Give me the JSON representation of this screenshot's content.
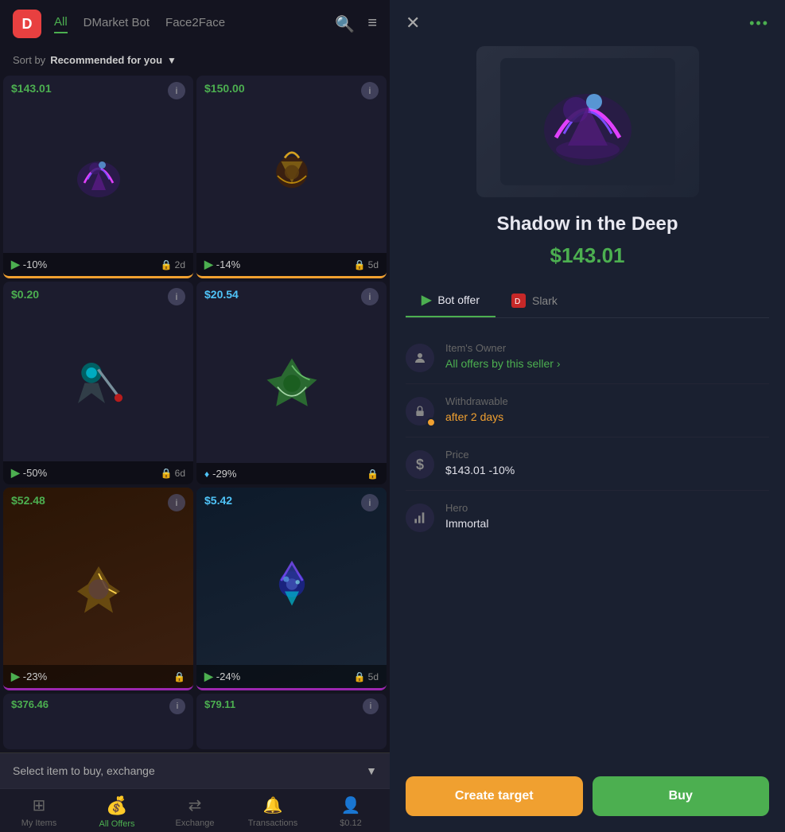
{
  "app": {
    "logo": "D",
    "logo_bg": "#e84040"
  },
  "header": {
    "tabs": [
      {
        "id": "all",
        "label": "All",
        "active": true
      },
      {
        "id": "dmarket",
        "label": "DMarket Bot",
        "active": false
      },
      {
        "id": "face2face",
        "label": "Face2Face",
        "active": false
      }
    ],
    "search_icon": "🔍",
    "filter_icon": "⚙"
  },
  "sort": {
    "prefix": "Sort by",
    "value": "Recommended for you",
    "chevron": "▼"
  },
  "items": [
    {
      "id": 1,
      "price": "$143.01",
      "price_color": "green",
      "discount": "-10%",
      "lock": "2d",
      "border": "yellow",
      "source": "dmarket"
    },
    {
      "id": 2,
      "price": "$150.00",
      "price_color": "green",
      "discount": "-14%",
      "lock": "5d",
      "border": "yellow",
      "source": "dmarket"
    },
    {
      "id": 3,
      "price": "$0.20",
      "price_color": "green",
      "discount": "-50%",
      "lock": "6d",
      "border": "none",
      "source": "dmarket"
    },
    {
      "id": 4,
      "price": "$20.54",
      "price_color": "blue",
      "discount": "-29%",
      "lock": "",
      "border": "none",
      "source": "steam"
    },
    {
      "id": 5,
      "price": "$52.48",
      "price_color": "green",
      "discount": "-23%",
      "lock": "",
      "border": "purple",
      "source": "dmarket"
    },
    {
      "id": 6,
      "price": "$5.42",
      "price_color": "blue",
      "discount": "-24%",
      "lock": "5d",
      "border": "purple",
      "source": "dmarket"
    },
    {
      "id": 7,
      "price": "$376.46",
      "price_color": "green",
      "discount": "",
      "lock": "",
      "border": "none",
      "source": "dmarket",
      "partial": true
    },
    {
      "id": 8,
      "price": "$79.11",
      "price_color": "green",
      "discount": "",
      "lock": "",
      "border": "none",
      "source": "dmarket",
      "partial": true
    }
  ],
  "select_bar": {
    "label": "Select item to buy, exchange",
    "icon": "▼"
  },
  "bottom_nav": [
    {
      "id": "my-items",
      "label": "My Items",
      "icon": "⊞",
      "active": false
    },
    {
      "id": "all-offers",
      "label": "All Offers",
      "icon": "💰",
      "active": true
    },
    {
      "id": "exchange",
      "label": "Exchange",
      "icon": "⇄",
      "active": false
    },
    {
      "id": "transactions",
      "label": "Transactions",
      "icon": "🔔",
      "active": false
    },
    {
      "id": "balance",
      "label": "$0.12",
      "icon": "👤",
      "active": false
    }
  ],
  "detail_panel": {
    "close_label": "✕",
    "more_label": "•••",
    "item_name": "Shadow in the Deep",
    "item_price": "$143.01",
    "offer_tabs": [
      {
        "id": "bot",
        "label": "Bot offer",
        "active": true,
        "icon": "▶"
      },
      {
        "id": "slark",
        "label": "Slark",
        "active": false,
        "icon_flag": true
      }
    ],
    "details": [
      {
        "id": "owner",
        "icon": "👤",
        "label": "Item's Owner",
        "value": "All offers by this seller",
        "type": "link",
        "has_warning": false
      },
      {
        "id": "withdrawable",
        "icon": "🔒",
        "label": "Withdrawable",
        "value": "after 2 days",
        "type": "orange",
        "has_warning": true
      },
      {
        "id": "price",
        "icon": "$",
        "label": "Price",
        "value": "$143.01  -10%",
        "type": "normal",
        "has_warning": false
      },
      {
        "id": "hero",
        "icon": "📊",
        "label": "Hero",
        "value": "Immortal",
        "type": "normal",
        "has_warning": false
      }
    ],
    "buttons": {
      "create_target": "Create target",
      "buy": "Buy"
    }
  }
}
